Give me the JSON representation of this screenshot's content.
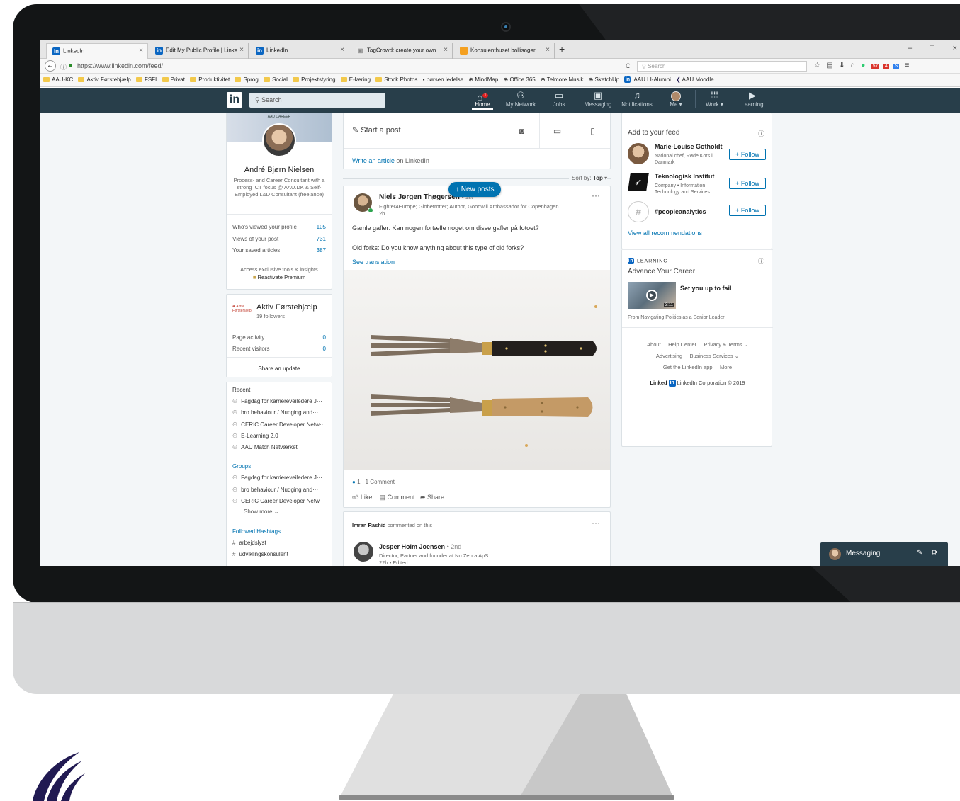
{
  "browser": {
    "tabs": [
      {
        "label": "LinkedIn",
        "active": true
      },
      {
        "label": "Edit My Public Profile | Linke"
      },
      {
        "label": "LinkedIn"
      },
      {
        "label": "TagCrowd: create your own"
      },
      {
        "label": "Konsulenthuset ballisager"
      }
    ],
    "new_tab_symbol": "+",
    "url": "https://www.linkedin.com/feed/",
    "search_placeholder": "Search",
    "reload_symbol": "C",
    "window_controls": [
      "–",
      "□",
      "×"
    ],
    "bookmarks": [
      "AAU-KC",
      "Aktiv Førstehjælp",
      "FSFI",
      "Privat",
      "Produktivitet",
      "Sprog",
      "Social",
      "Projektstyring",
      "E-læring",
      "Stock Photos",
      "børsen ledelse",
      "MindMap",
      "Office 365",
      "Telmore Musik",
      "SketchUp",
      "AAU LI-Alumni",
      "AAU Moodle"
    ],
    "addon_badges": [
      "57",
      "4"
    ]
  },
  "linkedin_nav": {
    "logo": "in",
    "search_placeholder": "Search",
    "items": [
      {
        "label": "Home",
        "icon": "home-icon",
        "badge": "1"
      },
      {
        "label": "My Network",
        "icon": "network-icon"
      },
      {
        "label": "Jobs",
        "icon": "briefcase-icon"
      },
      {
        "label": "Messaging",
        "icon": "messaging-icon"
      },
      {
        "label": "Notifications",
        "icon": "bell-icon"
      },
      {
        "label": "Me ▾",
        "icon": "avatar-icon"
      },
      {
        "label": "Work ▾",
        "icon": "grid-icon"
      },
      {
        "label": "Learning",
        "icon": "play-icon"
      }
    ]
  },
  "profile": {
    "banner_text": "AAU CAREER",
    "name": "André Bjørn Nielsen",
    "headline": "Process- and Career Consultant with a strong ICT focus @ AAU.DK & Self-Employed L&D Consultant (freelance)",
    "stats": [
      {
        "label": "Who's viewed your profile",
        "value": "105"
      },
      {
        "label": "Views of your post",
        "value": "731"
      },
      {
        "label": "Your saved articles",
        "value": "387"
      }
    ],
    "premium_text": "Access exclusive tools & insights",
    "premium_link": "Reactivate Premium"
  },
  "page_card": {
    "name": "Aktiv Førstehjælp",
    "followers": "19 followers",
    "stats": [
      {
        "label": "Page activity",
        "value": "0"
      },
      {
        "label": "Recent visitors",
        "value": "0"
      }
    ],
    "share": "Share an update"
  },
  "sidebar": {
    "recent_title": "Recent",
    "recent": [
      "Fagdag for karriereveiledere J···",
      "bro behaviour / Nudging and···",
      "CERIC Career Developer Netw···",
      "E-Learning 2.0",
      "AAU Match Netværket"
    ],
    "groups_title": "Groups",
    "groups": [
      "Fagdag for karriereveiledere J···",
      "bro behaviour / Nudging and···",
      "CERIC Career Developer Netw···"
    ],
    "show_more": "Show more",
    "hashtags_title": "Followed Hashtags",
    "hashtags": [
      "arbejdslyst",
      "udviklingskonsulent"
    ]
  },
  "share_box": {
    "start_post": "Start a post",
    "write_article": "Write an article",
    "write_article_suffix": "on LinkedIn"
  },
  "feed": {
    "sort_label": "Sort by:",
    "sort_value": "Top",
    "new_posts": "New posts",
    "post": {
      "author": "Niels Jørgen Thøgersen",
      "author_suffix": "• 1st",
      "subtitle": "Fighter4Europe; Globetrotter; Author, Goodwill Ambassador for Copenhagen",
      "time": "2h",
      "text1": "Gamle gafler: Kan nogen fortælle noget om disse gafler på fotoet?",
      "text2": "Old forks: Do you know anything about this type of old forks?",
      "see_translation": "See translation",
      "reactions": "1 · 1 Comment",
      "actions": [
        "Like",
        "Comment",
        "Share"
      ]
    },
    "post2": {
      "commenter": "Imran Rashid",
      "commented_text": "commented on this",
      "author": "Jesper Holm Joensen",
      "degree": "• 2nd",
      "subtitle": "Director, Partner and founder at No Zebra ApS",
      "time": "22h • Edited"
    },
    "more_symbol": "···"
  },
  "right_rail": {
    "feed_title": "Add to your feed",
    "suggestions": [
      {
        "name": "Marie-Louise Gotholdt",
        "subtitle": "National chef, Røde Kors i Danmark"
      },
      {
        "name": "Teknologisk Institut",
        "subtitle": "Company • Information Technology and Services"
      },
      {
        "name": "#peopleanalytics",
        "subtitle": ""
      }
    ],
    "follow_label": "+ Follow",
    "view_all": "View all recommendations",
    "learning_label": "LEARNING",
    "learning_title": "Advance Your Career",
    "course_title": "Set you up to fail",
    "course_duration": "3:11",
    "course_source": "From Navigating Politics as a Senior Leader",
    "footer_links": [
      "About",
      "Help Center",
      "Privacy & Terms ⌄",
      "Advertising",
      "Business Services ⌄",
      "Get the LinkedIn app",
      "More"
    ],
    "copyright": "LinkedIn Corporation © 2019",
    "logo_text": "Linked",
    "logo_in": "in"
  },
  "messaging": {
    "label": "Messaging"
  },
  "colors": {
    "linkedin_navy": "#283e4a",
    "linkedin_blue": "#0073b1",
    "feed_bg": "#f3f6f8",
    "aau_logo": "#211a52"
  }
}
